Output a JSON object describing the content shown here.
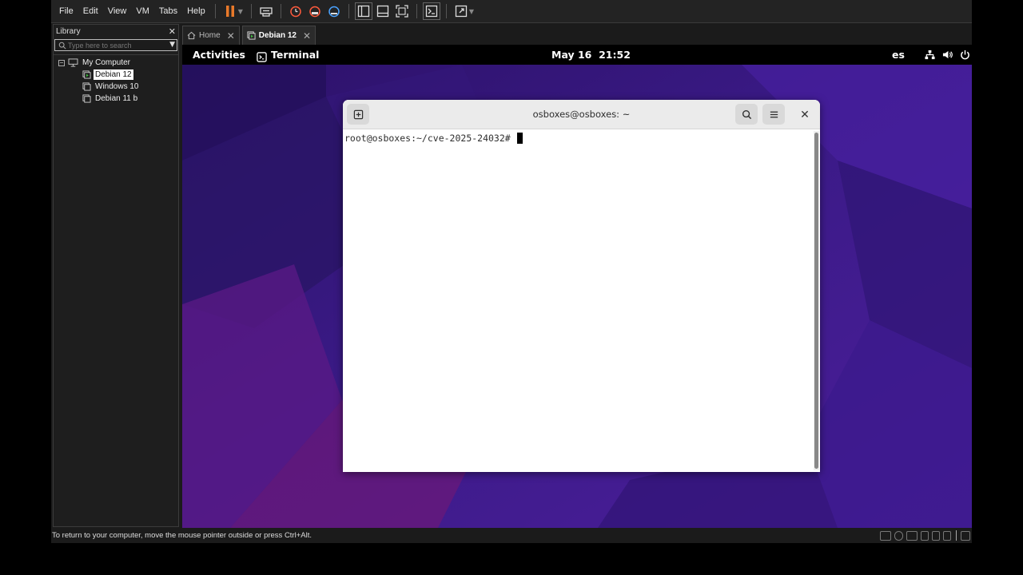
{
  "menubar": {
    "items": [
      "File",
      "Edit",
      "View",
      "VM",
      "Tabs",
      "Help"
    ],
    "toolbar_icons": [
      "pause-icon",
      "send-ctrl-alt-del-icon",
      "snapshot-take-icon",
      "snapshot-revert-icon",
      "snapshot-manager-icon",
      "library-view-icon",
      "thumbnail-bar-icon",
      "full-screen-icon",
      "console-view-icon",
      "unity-icon"
    ]
  },
  "library": {
    "title": "Library",
    "search_placeholder": "Type here to search",
    "root": "My Computer",
    "vms": [
      "Debian 12",
      "Windows 10",
      "Debian 11 b"
    ],
    "selected": "Debian 12"
  },
  "tabs": [
    {
      "label": "Home",
      "active": false
    },
    {
      "label": "Debian 12",
      "active": true
    }
  ],
  "guest": {
    "topbar": {
      "activities": "Activities",
      "app": "Terminal",
      "date": "May 16",
      "time": "21:52",
      "lang": "es"
    },
    "terminal": {
      "title": "osboxes@osboxes: ~",
      "prompt": "root@osboxes:~/cve-2025-24032# "
    }
  },
  "statusbar": {
    "text": "To return to your computer, move the mouse pointer outside or press Ctrl+Alt."
  },
  "colors": {
    "pause_accent": "#e8792a",
    "toolbar_icon_accent": "#ff5a3c",
    "desktop_purple": "#3f1d8a",
    "desktop_magenta": "#6a1570"
  }
}
